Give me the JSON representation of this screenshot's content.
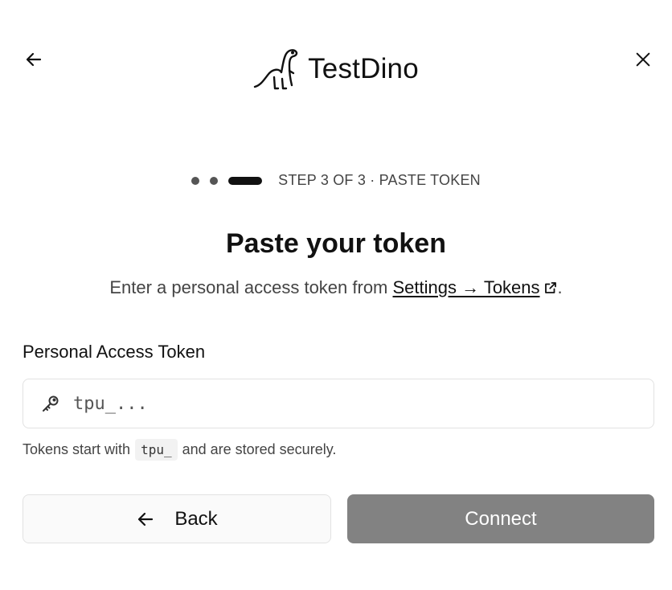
{
  "brand": {
    "name": "TestDino",
    "logo_icon": "dinosaur-icon"
  },
  "nav": {
    "back_icon": "arrow-left-icon",
    "close_icon": "close-icon"
  },
  "steps": {
    "total": 3,
    "current": 3,
    "label": "STEP 3 OF 3 · PASTE TOKEN"
  },
  "main": {
    "title": "Paste your token",
    "subtitle_prefix": "Enter a personal access token from ",
    "subtitle_link": "Settings → Tokens",
    "subtitle_suffix": "."
  },
  "form": {
    "label": "Personal Access Token",
    "placeholder": "tpu_...",
    "value": "",
    "hint_prefix": "Tokens start with",
    "hint_code": "tpu_",
    "hint_suffix": "and are stored securely."
  },
  "actions": {
    "back_label": "Back",
    "connect_label": "Connect"
  },
  "colors": {
    "connect_bg": "#828282",
    "text": "#111111",
    "muted": "#444444",
    "border": "#e2e2e2"
  }
}
